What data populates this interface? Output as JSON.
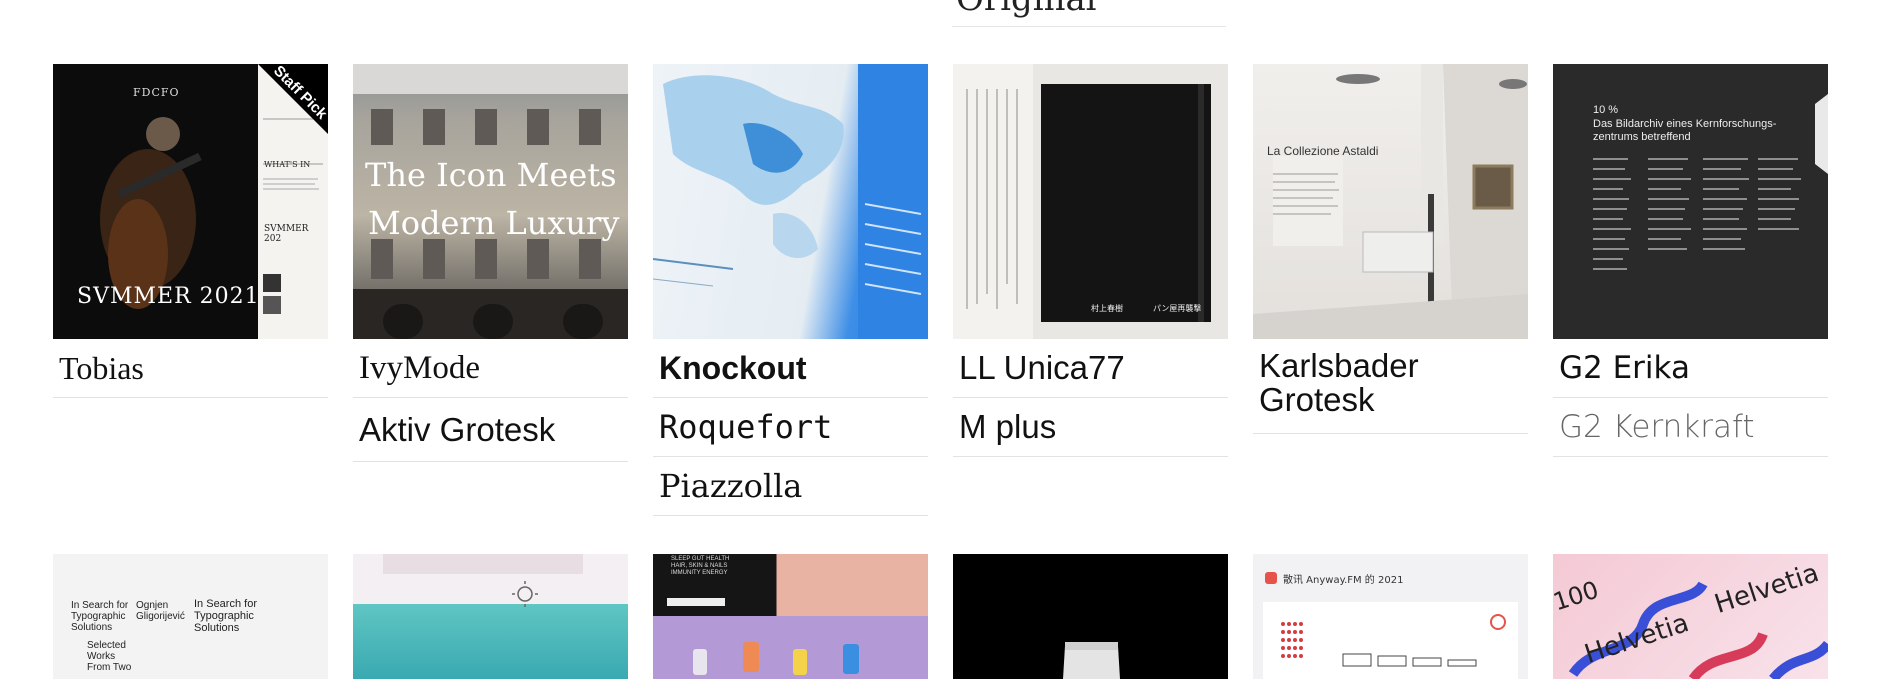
{
  "top_cut_label": "Original",
  "cards": [
    {
      "labels": [
        "Tobias"
      ],
      "badge": "Staff Pick",
      "thumb": {
        "masthead": "FDCFO",
        "big": "SVMMER 2021",
        "side1": "WHAT'S IN",
        "side2": "SVMMER 202"
      }
    },
    {
      "labels": [
        "IvyMode",
        "Aktiv Grotesk"
      ],
      "thumb": {
        "headline1": "The Icon Meets",
        "headline2": "Modern Luxury"
      }
    },
    {
      "labels": [
        "Knockout",
        "Roquefort",
        "Piazzolla"
      ],
      "thumb": {}
    },
    {
      "labels": [
        "LL Unica77",
        "M plus"
      ],
      "thumb": {
        "book1": "村上春樹",
        "book2": "パン屋再襲撃"
      }
    },
    {
      "labels": [
        "Karlsbader Grotesk"
      ],
      "thumb": {
        "wall": "La Collezione Astaldi"
      }
    },
    {
      "labels": [
        "G2 Erika",
        "G2 Kernkraft"
      ],
      "thumb": {
        "pct": "10 %",
        "title": "Das Bildarchiv eines Kernforschungs- zentrums betreffend"
      }
    }
  ],
  "bottom_thumbs": [
    {
      "text1": "In Search for Typographic Solutions",
      "text2": "Ognjen Gligorijević",
      "text3": "Selected Works From Two"
    },
    {
      "text1": ""
    },
    {
      "text1": "SLEEP GUT HEALTH HAIR, SKIN & NAILS IMMUNITY ENERGY"
    },
    {
      "text1": ""
    },
    {
      "text1": "散讯 Anyway.FM 的 2021"
    },
    {
      "text1": "Helvetia",
      "text2": "100"
    }
  ]
}
